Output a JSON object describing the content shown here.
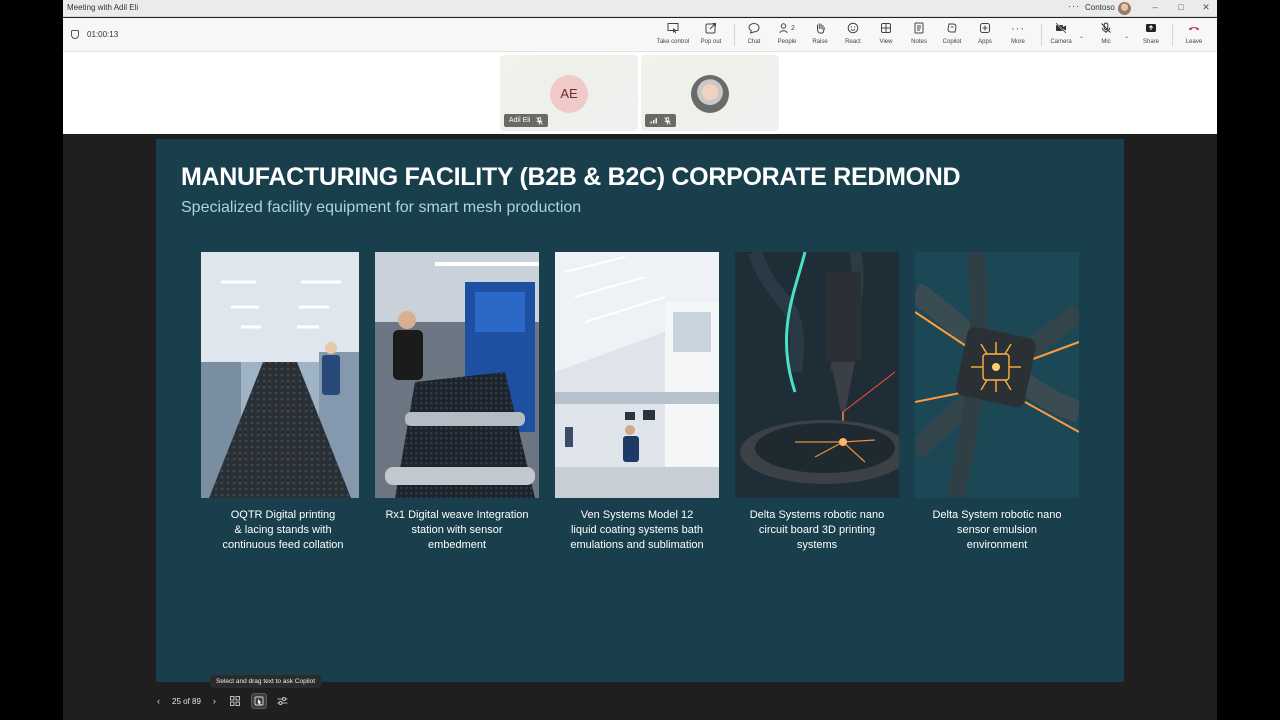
{
  "window": {
    "title": "Meeting with Adil Eli",
    "org": "Contoso",
    "more": "···",
    "minimize": "–",
    "maximize": "□",
    "close": "✕"
  },
  "toolbar": {
    "timer": "01:00:13",
    "buttons": [
      {
        "label": "Take control",
        "icon": "take-control-icon"
      },
      {
        "label": "Pop out",
        "icon": "pop-out-icon"
      },
      {
        "label": "Chat",
        "icon": "chat-icon"
      },
      {
        "label": "People",
        "icon": "people-icon",
        "count": "2"
      },
      {
        "label": "Raise",
        "icon": "raise-hand-icon"
      },
      {
        "label": "React",
        "icon": "react-icon"
      },
      {
        "label": "View",
        "icon": "view-icon"
      },
      {
        "label": "Notes",
        "icon": "notes-icon"
      },
      {
        "label": "Copilot",
        "icon": "copilot-icon"
      },
      {
        "label": "Apps",
        "icon": "apps-icon"
      },
      {
        "label": "More",
        "icon": "more-icon"
      },
      {
        "label": "Camera",
        "icon": "camera-off-icon"
      },
      {
        "label": "Mic",
        "icon": "mic-off-icon"
      },
      {
        "label": "Share",
        "icon": "share-icon"
      },
      {
        "label": "Leave",
        "icon": "leave-icon"
      }
    ]
  },
  "participants": [
    {
      "initials": "AE",
      "name": "Adil Eli",
      "muted": true
    },
    {
      "initials": "",
      "name": "",
      "muted": true
    }
  ],
  "slide": {
    "title": "MANUFACTURING FACILITY (B2B & B2C)  CORPORATE REDMOND",
    "subtitle": "Specialized facility equipment for smart mesh production",
    "cards": [
      {
        "caption_lines": [
          "OQTR Digital printing",
          "& lacing stands with",
          "continuous feed collation"
        ]
      },
      {
        "caption_lines": [
          "Rx1 Digital weave Integration",
          "station with sensor",
          "embedment"
        ]
      },
      {
        "caption_lines": [
          "Ven Systems Model 12",
          "liquid coating systems bath",
          "emulations and sublimation"
        ]
      },
      {
        "caption_lines": [
          "Delta Systems robotic nano",
          "circuit board 3D printing",
          "systems"
        ]
      },
      {
        "caption_lines": [
          "Delta System robotic nano",
          "sensor emulsion",
          "environment"
        ]
      }
    ]
  },
  "slide_controls": {
    "page": "25 of 89",
    "tooltip": "Select and drag text to ask Copilot"
  },
  "colors": {
    "slide_bg": "#193f4c",
    "subtitle": "#a9d4df",
    "leave": "#c4314b"
  }
}
